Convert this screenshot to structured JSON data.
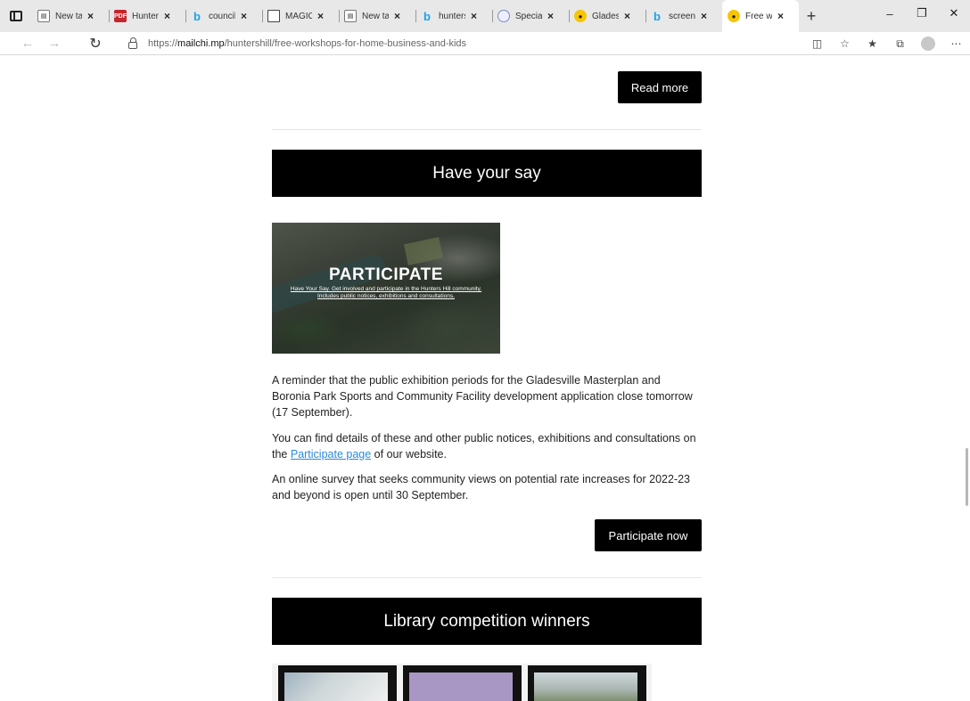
{
  "browser": {
    "tabs": [
      {
        "title": "New tab",
        "favicon": "page-icon"
      },
      {
        "title": "Hunters Hill",
        "favicon": "pdf-icon"
      },
      {
        "title": "council",
        "favicon": "bing-icon"
      },
      {
        "title": "MAGIC",
        "favicon": "document-icon"
      },
      {
        "title": "New tab",
        "favicon": "page-icon"
      },
      {
        "title": "hunters",
        "favicon": "bing-icon"
      },
      {
        "title": "Special",
        "favicon": "globe-icon"
      },
      {
        "title": "Gladesville",
        "favicon": "mailchimp-icon"
      },
      {
        "title": "screen",
        "favicon": "bing-icon"
      },
      {
        "title": "Free w",
        "favicon": "mailchimp-icon",
        "active": true
      }
    ],
    "address": {
      "prefix": "https://",
      "host": "mailchi.mp",
      "path": "/huntershill/free-workshops-for-home-business-and-kids"
    }
  },
  "page": {
    "read_more_label": "Read more",
    "have_your_say_heading": "Have your say",
    "hero": {
      "title": "PARTICIPATE",
      "subtitle": "Have Your Say. Get involved and participate in the Hunters Hill community. Includes public notices, exhibitions and consultations."
    },
    "paragraph1": "A reminder that the public exhibition periods for the Gladesville Masterplan and Boronia Park Sports and Community Facility development application close tomorrow (17 September).",
    "paragraph2_before": "You can find details of these and other public notices, exhibitions and consultations on the ",
    "paragraph2_link": "Participate page",
    "paragraph2_after": " of our website.",
    "paragraph3": "An online survey that seeks community views on potential rate increases for 2022-23 and beyond is open until 30 September.",
    "participate_now_label": "Participate now",
    "library_heading": "Library competition winners"
  }
}
